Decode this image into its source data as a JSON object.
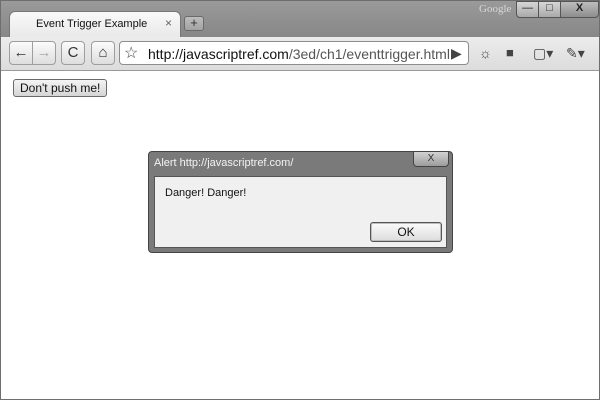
{
  "browser": {
    "tab_title": "Event Trigger Example",
    "tab_close": "×",
    "new_tab": "+",
    "brand": "Google",
    "window_controls": {
      "minimize": "—",
      "maximize": "□",
      "close": "X"
    }
  },
  "toolbar": {
    "back": "←",
    "forward": "→",
    "reload": "C",
    "home": "⌂",
    "star": "☆",
    "url_domain": "http://javascriptref.com",
    "url_path": "/3ed/ch1/eventtrigger.html",
    "go": "▶",
    "extension_icon": "☼",
    "page_menu_icon": "▢▾",
    "wrench_icon": "✎▾"
  },
  "page": {
    "button_label": "Don't push me!"
  },
  "alert": {
    "title": "Alert http://javascriptref.com/",
    "close": "X",
    "message": "Danger! Danger!",
    "ok_label": "OK"
  }
}
